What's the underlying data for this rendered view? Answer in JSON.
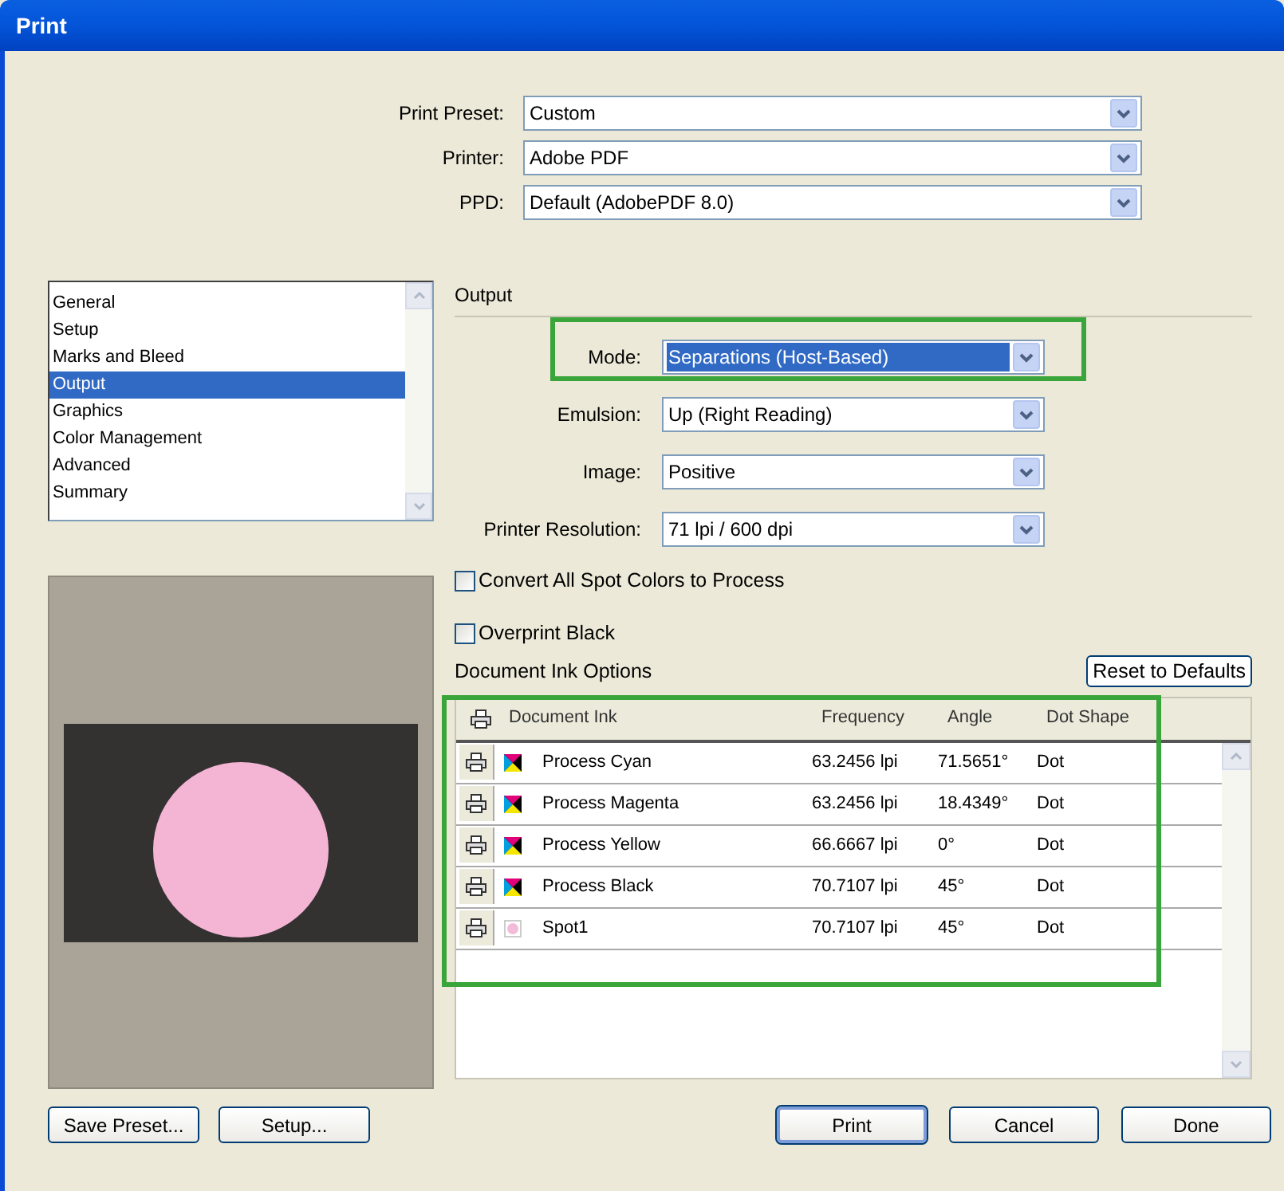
{
  "window": {
    "title": "Print"
  },
  "top_fields": [
    {
      "label": "Print Preset:",
      "value": "Custom"
    },
    {
      "label": "Printer:",
      "value": "Adobe PDF"
    },
    {
      "label": "PPD:",
      "value": "Default (AdobePDF 8.0)"
    }
  ],
  "categories": [
    {
      "label": "General",
      "selected": false
    },
    {
      "label": "Setup",
      "selected": false
    },
    {
      "label": "Marks and Bleed",
      "selected": false
    },
    {
      "label": "Output",
      "selected": true
    },
    {
      "label": "Graphics",
      "selected": false
    },
    {
      "label": "Color Management",
      "selected": false
    },
    {
      "label": "Advanced",
      "selected": false
    },
    {
      "label": "Summary",
      "selected": false
    }
  ],
  "section_title": "Output",
  "output_fields": [
    {
      "label": "Mode:",
      "value": "Separations (Host-Based)",
      "focused": true
    },
    {
      "label": "Emulsion:",
      "value": "Up (Right Reading)",
      "focused": false
    },
    {
      "label": "Image:",
      "value": "Positive",
      "focused": false
    },
    {
      "label": "Printer Resolution:",
      "value": "71 lpi / 600 dpi",
      "focused": false
    }
  ],
  "checkboxes": [
    {
      "label": "Convert All Spot Colors to Process",
      "checked": false
    },
    {
      "label": "Overprint Black",
      "checked": false
    }
  ],
  "ink_options": {
    "title": "Document Ink Options",
    "reset_button": "Reset to Defaults",
    "columns": [
      "Document Ink",
      "Frequency",
      "Angle",
      "Dot Shape"
    ],
    "rows": [
      {
        "kind": "process",
        "name": "Process Cyan",
        "frequency": "63.2456 lpi",
        "angle": "71.5651°",
        "dot_shape": "Dot"
      },
      {
        "kind": "process",
        "name": "Process Magenta",
        "frequency": "63.2456 lpi",
        "angle": "18.4349°",
        "dot_shape": "Dot"
      },
      {
        "kind": "process",
        "name": "Process Yellow",
        "frequency": "66.6667 lpi",
        "angle": "0°",
        "dot_shape": "Dot"
      },
      {
        "kind": "process",
        "name": "Process Black",
        "frequency": "70.7107 lpi",
        "angle": "45°",
        "dot_shape": "Dot"
      },
      {
        "kind": "spot",
        "color": "#f2bcd8",
        "name": "Spot1",
        "frequency": "70.7107 lpi",
        "angle": "45°",
        "dot_shape": "Dot"
      }
    ]
  },
  "buttons_left": [
    {
      "label": "Save Preset...",
      "default": false
    },
    {
      "label": "Setup...",
      "default": false
    }
  ],
  "buttons_right": [
    {
      "label": "Print",
      "default": true
    },
    {
      "label": "Cancel",
      "default": false
    },
    {
      "label": "Done",
      "default": false
    }
  ]
}
